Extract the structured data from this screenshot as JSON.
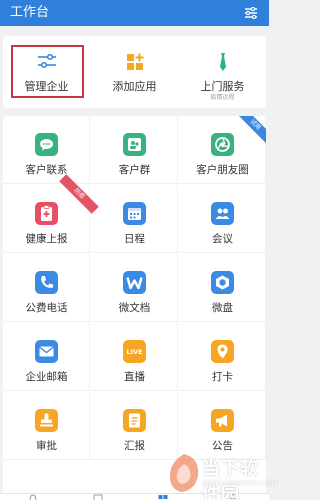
{
  "header": {
    "title": "工作台",
    "menu_icon": "sliders-icon"
  },
  "top_row": [
    {
      "label": "管理企业",
      "icon": "sliders-icon",
      "highlighted": true
    },
    {
      "label": "添加应用",
      "icon": "add-app-icon"
    },
    {
      "label": "上门服务",
      "sublabel": "疫情远程",
      "icon": "tie-icon"
    }
  ],
  "apps": [
    {
      "label": "客户联系",
      "icon": "chat-icon",
      "color": "#36b37e"
    },
    {
      "label": "客户群",
      "icon": "group-icon",
      "color": "#36b37e"
    },
    {
      "label": "客户朋友圈",
      "icon": "aperture-icon",
      "color": "#36b37e",
      "ribbon": "试用"
    },
    {
      "label": "健康上报",
      "icon": "clipboard-plus-icon",
      "color": "#e94f64",
      "ribbon": "防疫"
    },
    {
      "label": "日程",
      "icon": "calendar-icon",
      "color": "#3b8ae3"
    },
    {
      "label": "会议",
      "icon": "people-icon",
      "color": "#3b8ae3"
    },
    {
      "label": "公费电话",
      "icon": "phone-icon",
      "color": "#3b8ae3"
    },
    {
      "label": "微文档",
      "icon": "w-doc-icon",
      "color": "#3b8ae3"
    },
    {
      "label": "微盘",
      "icon": "drive-icon",
      "color": "#3b8ae3"
    },
    {
      "label": "企业邮箱",
      "icon": "mail-icon",
      "color": "#3b8ae3"
    },
    {
      "label": "直播",
      "icon": "live-icon",
      "color": "#f6a623",
      "badge_text": "LIVE"
    },
    {
      "label": "打卡",
      "icon": "location-icon",
      "color": "#f6a623"
    },
    {
      "label": "审批",
      "icon": "stamp-icon",
      "color": "#f6a623"
    },
    {
      "label": "汇报",
      "icon": "report-icon",
      "color": "#f6a623"
    },
    {
      "label": "公告",
      "icon": "megaphone-icon",
      "color": "#f6a623"
    }
  ],
  "watermark": {
    "text": "当下软件园",
    "url": "www.downxia.com"
  },
  "colors": {
    "brand": "#2f7fdb",
    "highlight": "#c8373d",
    "green": "#36b37e",
    "blue": "#3b8ae3",
    "red": "#e94f64",
    "orange": "#f6a623"
  }
}
